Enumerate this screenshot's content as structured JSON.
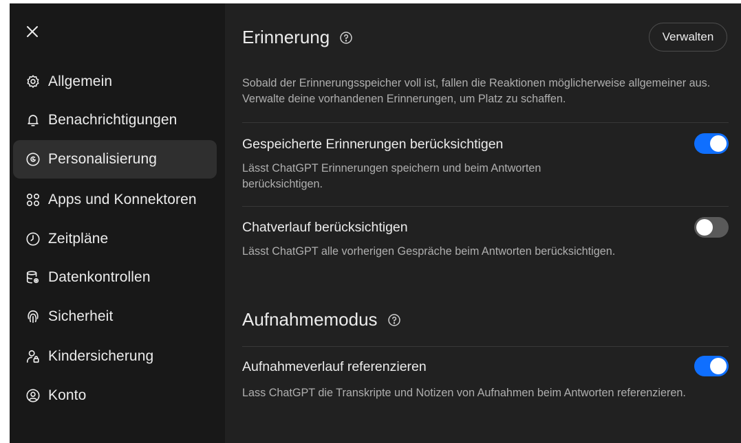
{
  "sidebar": {
    "close_icon": "close-icon",
    "items": [
      {
        "label": "Allgemein",
        "icon": "gear-icon",
        "active": false
      },
      {
        "label": "Benachrichtigungen",
        "icon": "bell-icon",
        "active": false
      },
      {
        "label": "Personalisierung",
        "icon": "personalize-icon",
        "active": true
      },
      {
        "label": "Apps und Konnektoren",
        "icon": "apps-icon",
        "active": false
      },
      {
        "label": "Zeitpläne",
        "icon": "clock-icon",
        "active": false
      },
      {
        "label": "Datenkontrollen",
        "icon": "database-icon",
        "active": false
      },
      {
        "label": "Sicherheit",
        "icon": "fingerprint-icon",
        "active": false
      },
      {
        "label": "Kindersicherung",
        "icon": "parental-icon",
        "active": false
      },
      {
        "label": "Konto",
        "icon": "account-icon",
        "active": false
      }
    ]
  },
  "memory": {
    "title": "Erinnerung",
    "manage_label": "Verwalten",
    "description": "Sobald der Erinnerungsspeicher voll ist, fallen die Reaktionen möglicherweise allgemeiner aus. Verwalte deine vorhandenen Erinnerungen, um Platz zu schaffen.",
    "settings": [
      {
        "title": "Gespeicherte Erinnerungen berücksichtigen",
        "description": "Lässt ChatGPT Erinnerungen speichern und beim Antworten berücksichtigen.",
        "enabled": true
      },
      {
        "title": "Chatverlauf berücksichtigen",
        "description": "Lässt ChatGPT alle vorherigen Gespräche beim Antworten berücksichtigen.",
        "enabled": false
      }
    ]
  },
  "recording": {
    "title": "Aufnahmemodus",
    "settings": [
      {
        "title": "Aufnahmeverlauf referenzieren",
        "description": "Lass ChatGPT die Transkripte und Notizen von Aufnahmen beim Antworten referenzieren.",
        "enabled": true
      }
    ]
  },
  "colors": {
    "toggle_on": "#0f6fff",
    "toggle_off": "#5a5a5a",
    "panel_bg": "#212121",
    "sidebar_bg": "#181818"
  }
}
